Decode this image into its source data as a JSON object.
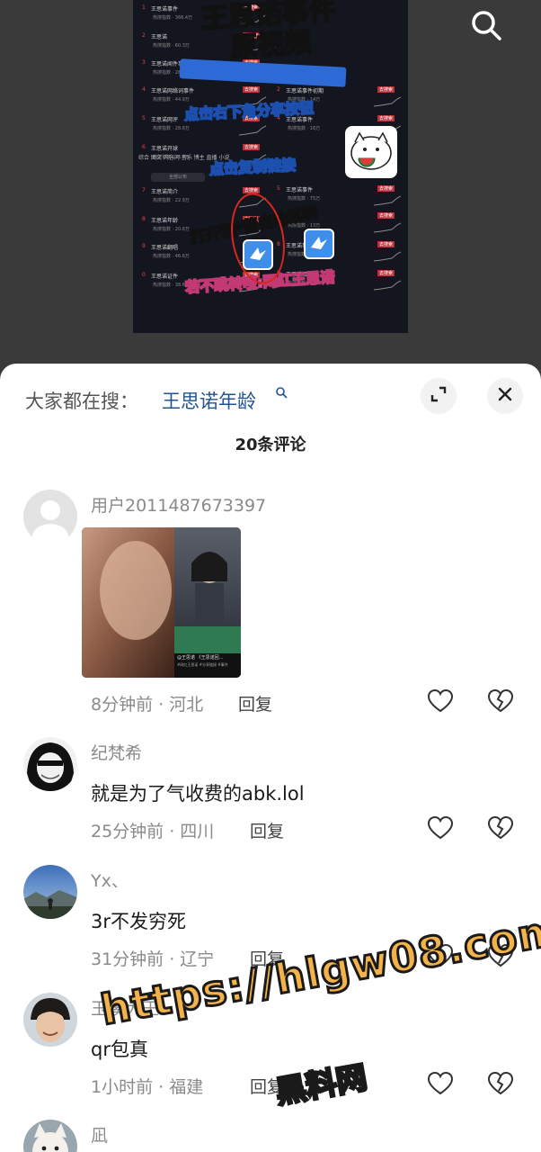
{
  "video": {
    "overlay_title": "王思诺事件\n原视频",
    "step1": "点击右下角分享按钮",
    "step2": "点击复制链接",
    "step3": "打开训*蕾自动跳转",
    "step4": "若不跳转嗖:网红王思诺",
    "tabs": "综合  图文  内容问  音乐  博主  直播  小说",
    "select_label": "全部公布",
    "rows": [
      {
        "num": "1",
        "name": "王思诺事件",
        "sub": "热搜指数 · 366.4万",
        "tag": "去搜索"
      },
      {
        "num": "2",
        "name": "王思诺",
        "sub": "热搜指数 · 60.3万",
        "tag": "去搜索"
      },
      {
        "num": "3",
        "name": "王思诺闻件事件",
        "sub": "热搜指数 · 26.7万",
        "tag": "去搜索"
      },
      {
        "num": "4",
        "name": "王思诺网络词事件",
        "sub": "热搜指数 · 44.9万",
        "tag": "去搜索"
      },
      {
        "num": "5",
        "name": "王思诺网评",
        "sub": "热搜指数 · 28.6万",
        "tag": "去搜索"
      },
      {
        "num": "6",
        "name": "王思诺开球",
        "sub": "热搜指数 · 26.4万",
        "tag": "去搜索"
      },
      {
        "num": "7",
        "name": "王思诺简介",
        "sub": "热搜指数 · 22.9万",
        "tag": "去搜索"
      },
      {
        "num": "8",
        "name": "王思诺年龄",
        "sub": "热搜指数 · 20.6万",
        "tag": "去搜索"
      },
      {
        "num": "9",
        "name": "王思诺翻唱",
        "sub": "热搜指数 · 46.6万",
        "tag": "去搜索"
      },
      {
        "num": "0",
        "name": "王思诺证件",
        "sub": "热搜指数 · 38.6万",
        "tag": "去搜索"
      }
    ],
    "right_rows": [
      {
        "num": "2",
        "name": "王思诺事件初期",
        "sub": "热搜指数 · 14万",
        "tag": "去搜索"
      },
      {
        "num": "4",
        "name": "王思诺事件",
        "sub": "热搜指数 · 16万",
        "tag": "去搜索"
      },
      {
        "num": "5",
        "name": "王思诺事件",
        "sub": "热搜指数 · 75万",
        "tag": "去搜索"
      },
      {
        "num": "7",
        "name": "王思诺",
        "sub": "热搜指数 · 13万",
        "tag": "去搜索"
      },
      {
        "num": "8",
        "name": "王思诺事件",
        "sub": "热搜指数 · 16万",
        "tag": "去搜索"
      },
      {
        "num": "9",
        "name": "王思诺红王",
        "sub": "热搜指数 · 43.5万",
        "tag": "去搜索"
      }
    ]
  },
  "sheet": {
    "hot_search_prefix": "大家都在搜：",
    "hot_search_term": "王思诺年龄",
    "comment_count": "20条评论",
    "reply_label": "回复"
  },
  "comments": [
    {
      "username": "用户2011487673397",
      "text": "",
      "meta": "8分钟前 · 河北",
      "thumb_caption": "@王思诺 《王思诺回…",
      "thumb_caption2": "#网红王思诺 #分享链接 #事件"
    },
    {
      "username": "纪梵希",
      "text": "就是为了气收费的abk.lol",
      "meta": "25分钟前 · 四川"
    },
    {
      "username": "Yx、",
      "text": "3r不发穷死",
      "meta": "31分钟前 · 辽宁"
    },
    {
      "username": "玉溪大王",
      "text": "qr包真",
      "meta": "1小时前 · 福建"
    },
    {
      "username": "凪",
      "text": "",
      "meta": ""
    }
  ],
  "watermark": {
    "url": "https://hlgw08.com",
    "name": "黑料网"
  },
  "colors": {
    "accent": "#215493",
    "sheet_bg": "#ffffff",
    "meta_gray": "#8a8a8a",
    "watermark": "#f3b24a"
  }
}
